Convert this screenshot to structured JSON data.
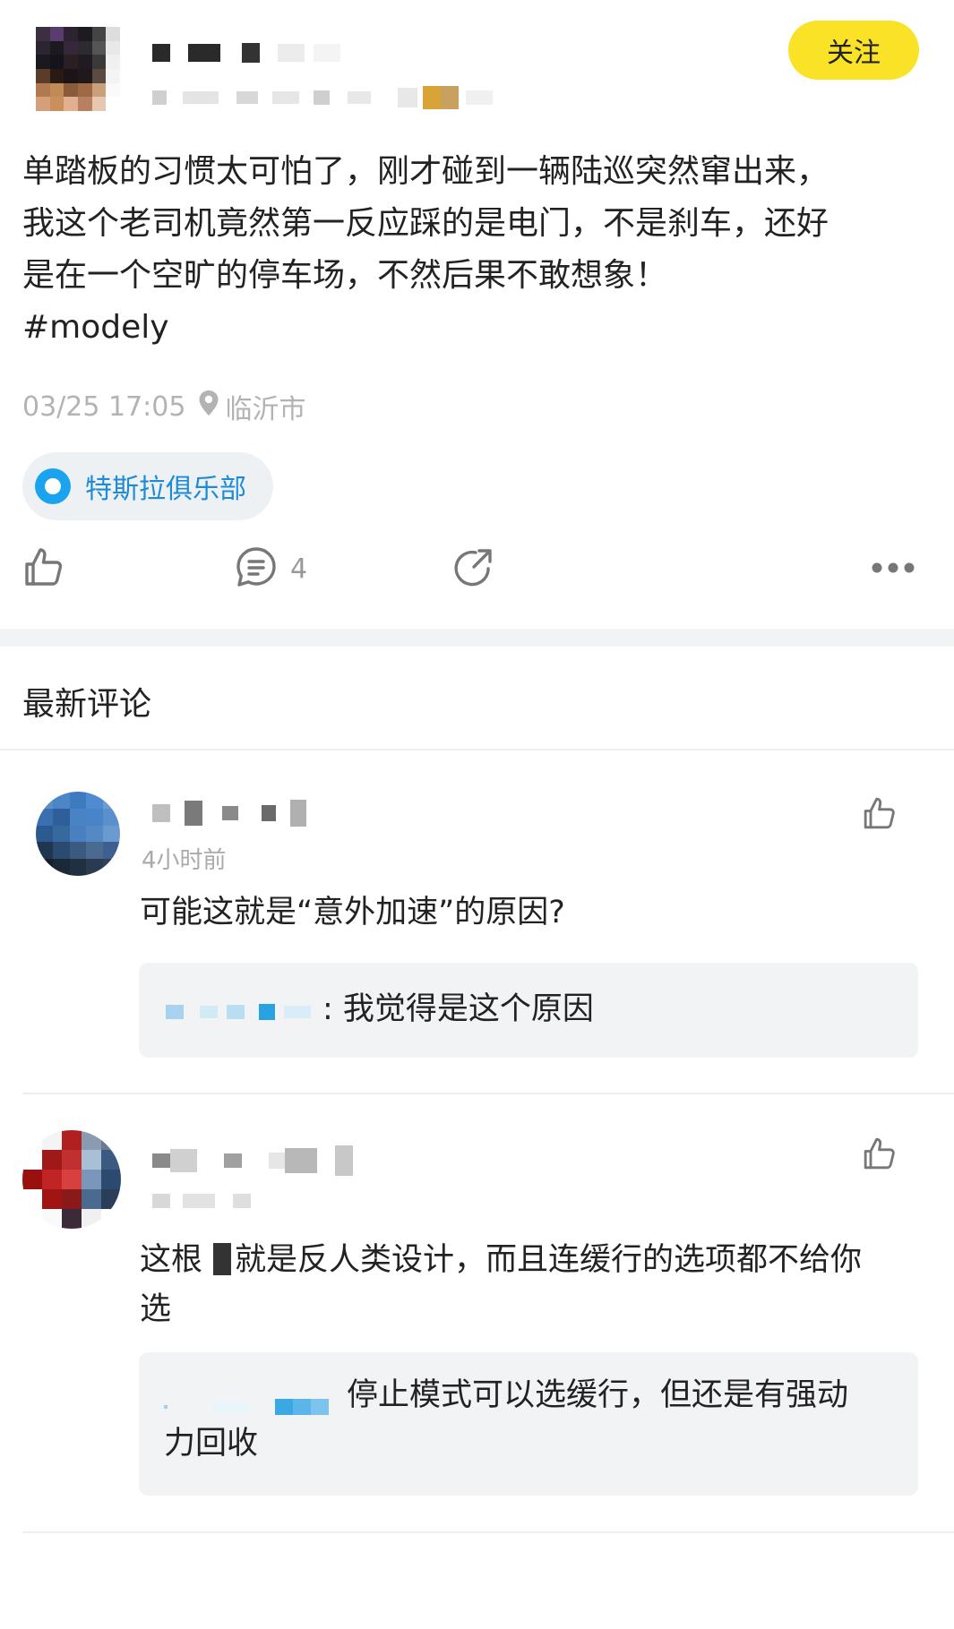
{
  "post": {
    "follow_label": "关注",
    "text_lines": [
      "单踏板的习惯太可怕了，刚才碰到一辆陆巡突然窜出来，",
      "我这个老司机竟然第一反应踩的是电门，不是刹车，还好",
      "是在一个空旷的停车场，不然后果不敢想象！"
    ],
    "hashtag": "#modely",
    "timestamp": "03/25 17:05",
    "location": "临沂市",
    "club_tag": "特斯拉俱乐部",
    "comment_count": "4"
  },
  "icons": {
    "like": "thumbs-up-icon",
    "comment": "comment-bubble-icon",
    "share": "share-arrow-icon",
    "more": "more-dots-icon",
    "location": "location-pin-icon",
    "club": "circle-dot-icon"
  },
  "colors": {
    "follow_bg": "#fae326",
    "club_text": "#1e8bd6",
    "club_dot": "#1aa4ef",
    "reply_bg": "#f2f3f5",
    "meta_gray": "#b3b3b3"
  },
  "comments_section": {
    "title": "最新评论",
    "comments": [
      {
        "time": "4小时前",
        "text": "可能这就是“意外加速”的原因?",
        "reply": {
          "text": ": 我觉得是这个原因"
        }
      },
      {
        "text_before": "这根",
        "text_after": "就是反人类设计，而且连缓行的选项都不给你",
        "text_line2": "选",
        "reply": {
          "text_line1": "停止模式可以选缓行，但还是有强动",
          "text_line2": "力回收"
        }
      }
    ]
  }
}
